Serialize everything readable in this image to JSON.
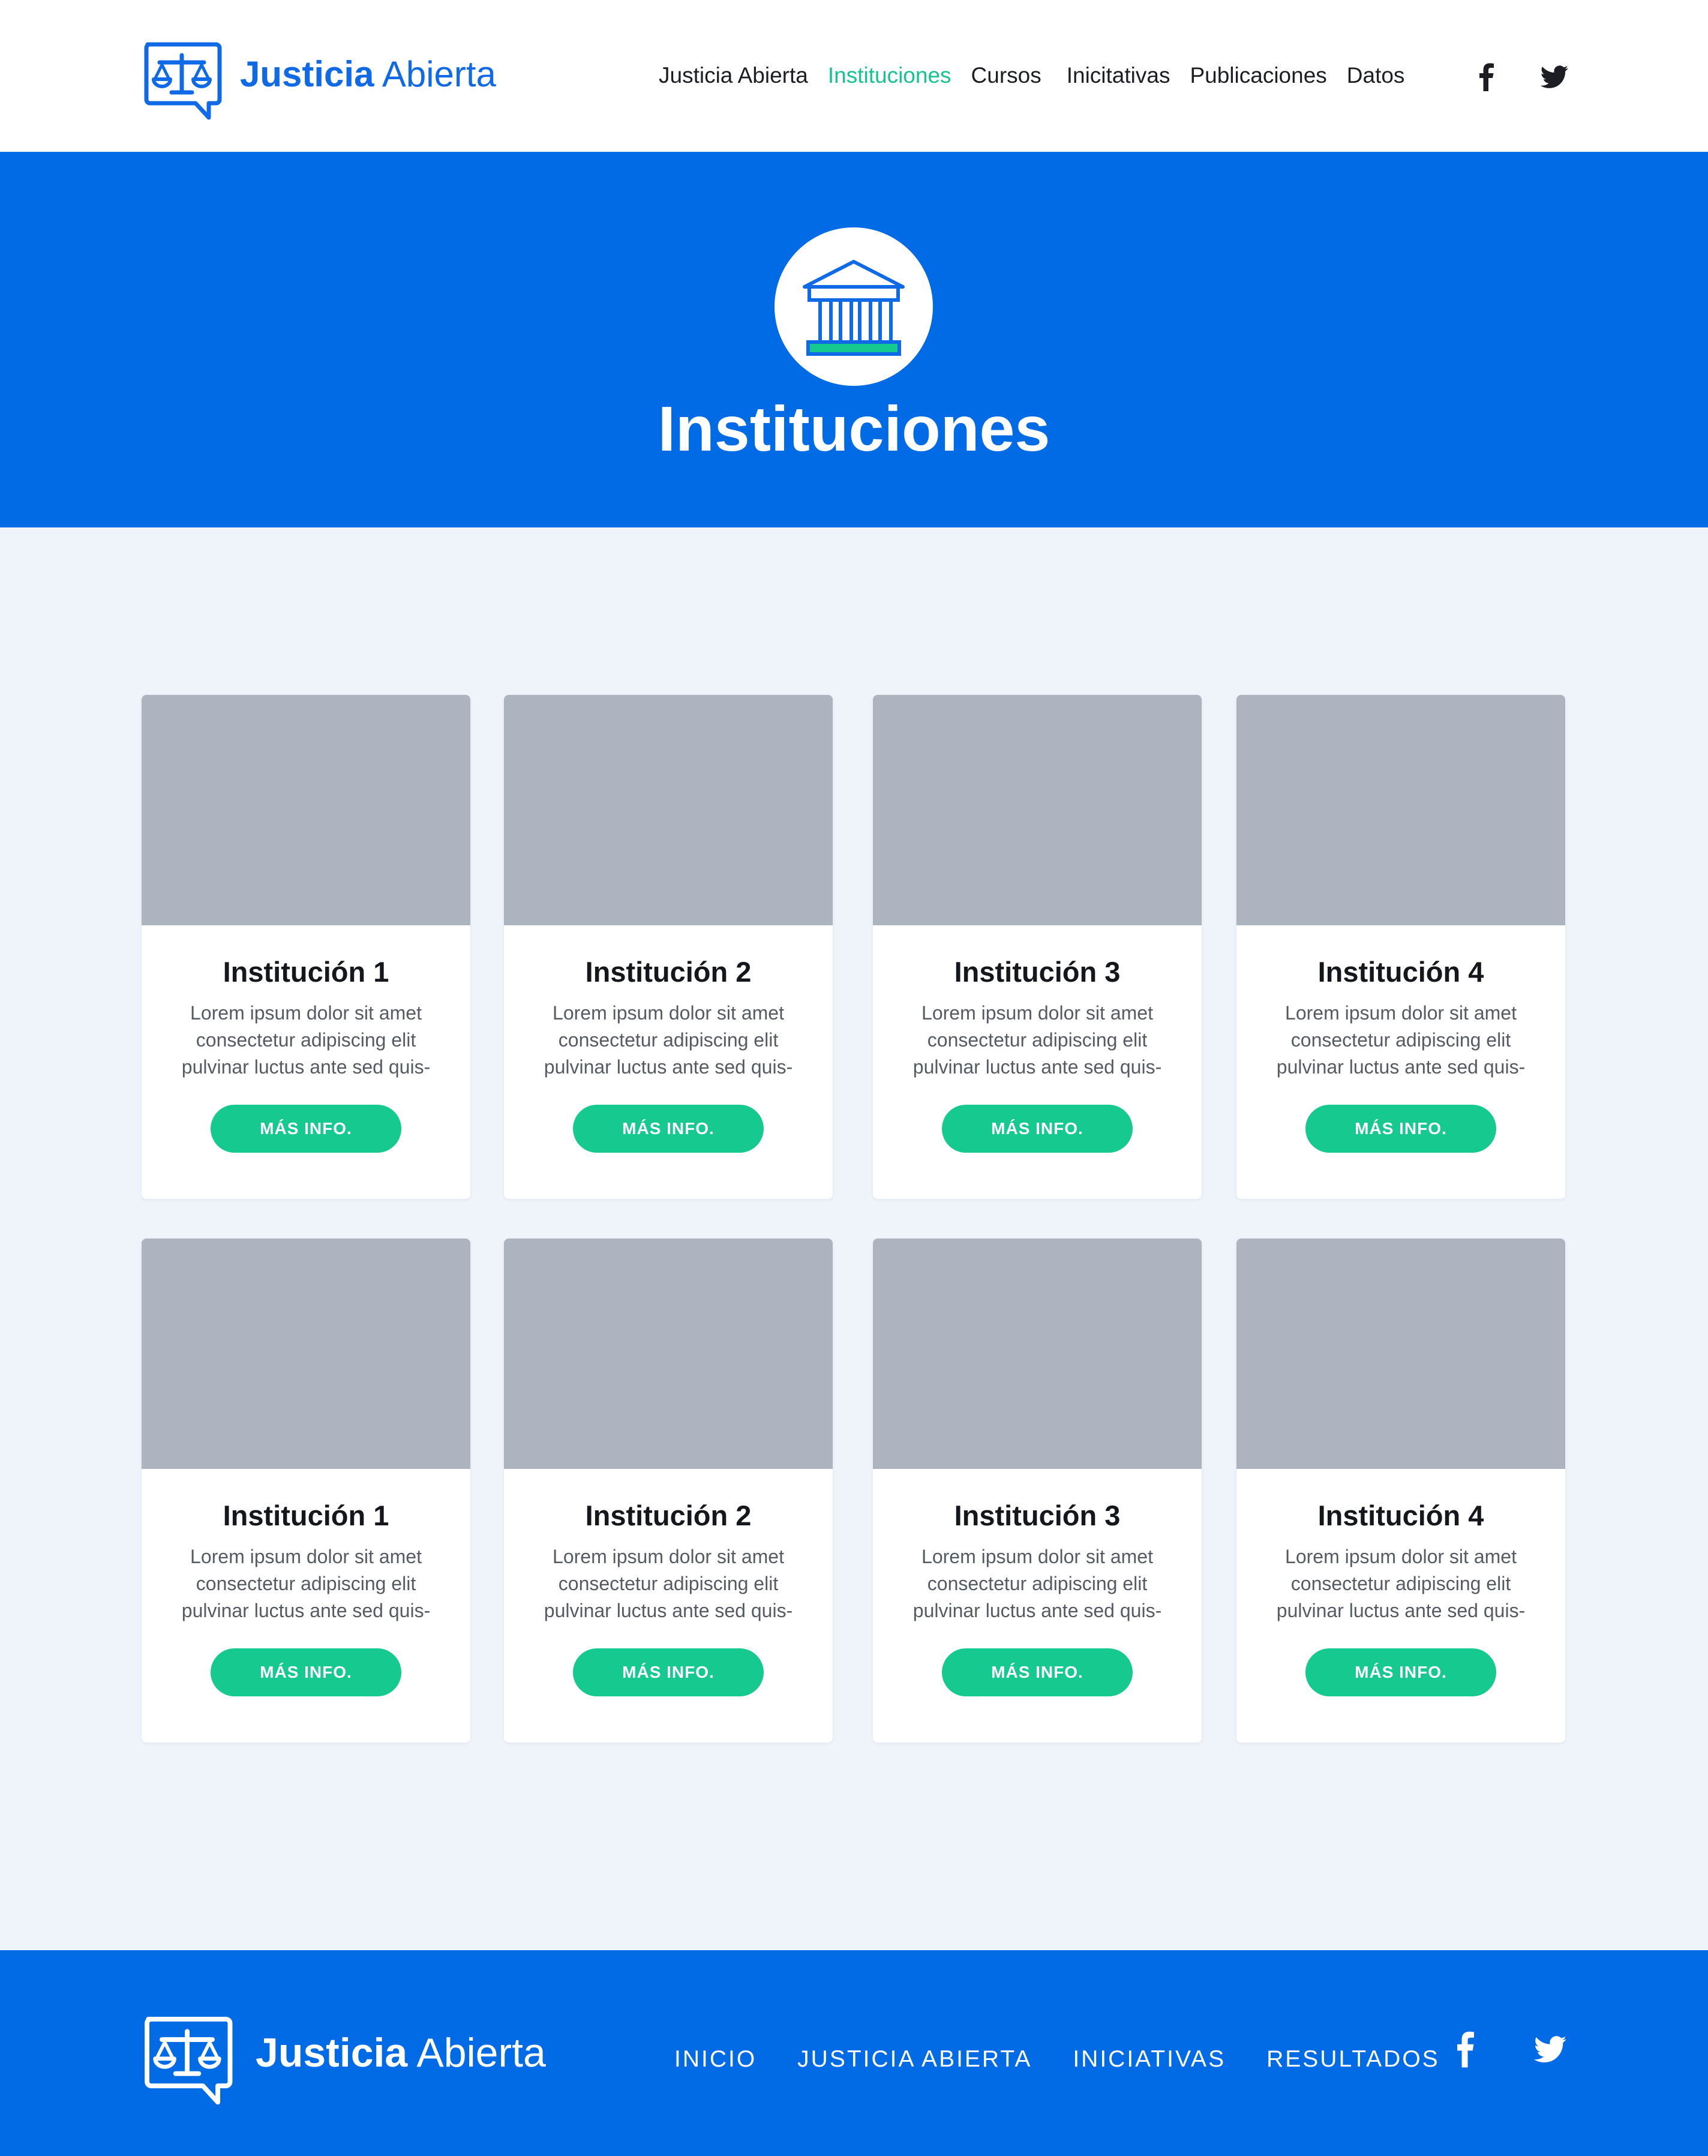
{
  "colors": {
    "brand_blue": "#016ae5",
    "accent_green": "#16c98f",
    "page_bg": "#eff3fa",
    "image_placeholder": "#adb4bf"
  },
  "header": {
    "brand": {
      "bold": "Justicia",
      "light": "Abierta",
      "logo_icon": "scales-chat-icon"
    },
    "nav": [
      {
        "label": "Justicia Abierta",
        "active": false
      },
      {
        "label": "Instituciones",
        "active": true
      },
      {
        "label": "Cursos",
        "active": false
      },
      {
        "label": "Inicitativas",
        "active": false
      },
      {
        "label": "Publicaciones",
        "active": false
      },
      {
        "label": "Datos",
        "active": false
      }
    ],
    "social": [
      "facebook-icon",
      "twitter-icon"
    ]
  },
  "hero": {
    "icon": "institution-building-icon",
    "title": "Instituciones"
  },
  "cards": [
    {
      "title": "Institución 1",
      "description": "Lorem ipsum dolor sit amet consectetur adipiscing elit pulvinar luctus ante sed quis-",
      "button": "MÁS INFO."
    },
    {
      "title": "Institución 2",
      "description": "Lorem ipsum dolor sit amet consectetur adipiscing elit pulvinar luctus ante sed quis-",
      "button": "MÁS INFO."
    },
    {
      "title": "Institución 3",
      "description": "Lorem ipsum dolor sit amet consectetur adipiscing elit pulvinar luctus ante sed quis-",
      "button": "MÁS INFO."
    },
    {
      "title": "Institución 4",
      "description": "Lorem ipsum dolor sit amet consectetur adipiscing elit pulvinar luctus ante sed quis-",
      "button": "MÁS INFO."
    },
    {
      "title": "Institución 1",
      "description": "Lorem ipsum dolor sit amet consectetur adipiscing elit pulvinar luctus ante sed quis-",
      "button": "MÁS INFO."
    },
    {
      "title": "Institución 2",
      "description": "Lorem ipsum dolor sit amet consectetur adipiscing elit pulvinar luctus ante sed quis-",
      "button": "MÁS INFO."
    },
    {
      "title": "Institución 3",
      "description": "Lorem ipsum dolor sit amet consectetur adipiscing elit pulvinar luctus ante sed quis-",
      "button": "MÁS INFO."
    },
    {
      "title": "Institución 4",
      "description": "Lorem ipsum dolor sit amet consectetur adipiscing elit pulvinar luctus ante sed quis-",
      "button": "MÁS INFO."
    }
  ],
  "footer": {
    "brand": {
      "bold": "Justicia",
      "light": "Abierta",
      "logo_icon": "scales-chat-icon"
    },
    "nav": [
      "INICIO",
      "JUSTICIA ABIERTA",
      "INICIATIVAS",
      "RESULTADOS"
    ],
    "social": [
      "facebook-icon",
      "twitter-icon"
    ]
  }
}
